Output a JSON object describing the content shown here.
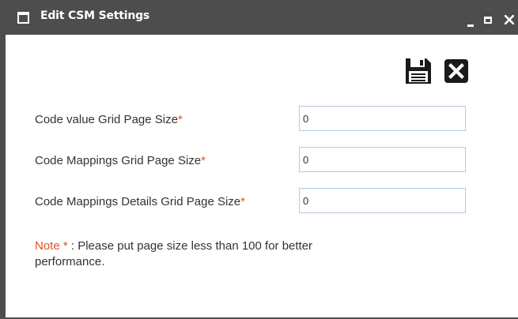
{
  "window": {
    "title": "Edit CSM Settings",
    "icons": [
      "window-icon",
      "minimize-icon",
      "maximize-icon",
      "close-icon",
      "save-icon",
      "cancel-icon"
    ]
  },
  "colors": {
    "titlebar": "#4d4d4d",
    "required_marker": "#e8501f",
    "input_border": "#b7c9dd",
    "text": "#333333"
  },
  "form": {
    "fields": [
      {
        "label": "Code value Grid Page Size",
        "required": "*",
        "value": "0"
      },
      {
        "label": "Code Mappings Grid Page Size",
        "required": "*",
        "value": "0"
      },
      {
        "label": "Code Mappings Details Grid Page Size",
        "required": "*",
        "value": "0"
      }
    ]
  },
  "note": {
    "label": "Note * ",
    "text": ": Please put page size less than 100 for better performance."
  }
}
